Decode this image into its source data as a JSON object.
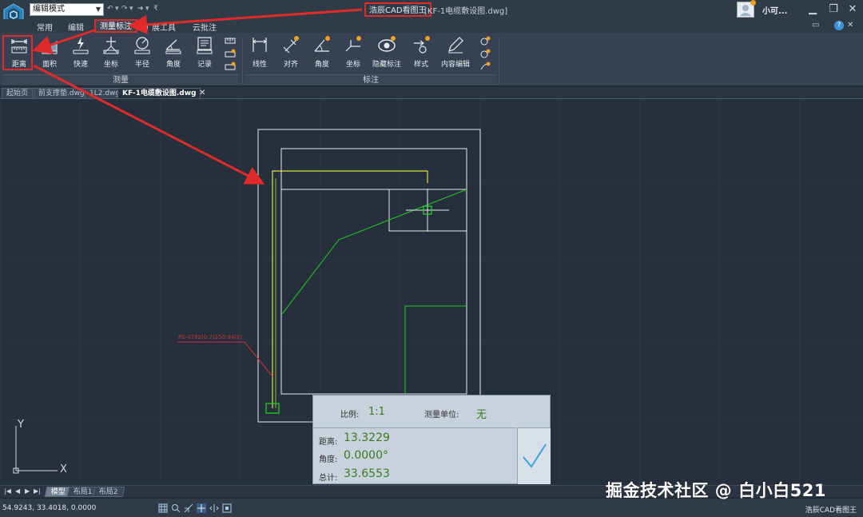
{
  "titlebar": {
    "mode_value": "编辑模式",
    "app_name": "浩辰CAD看图王",
    "file_title": "[KF-1电缆敷设图.dwg]",
    "username": "小可..."
  },
  "menu": {
    "tabs": [
      {
        "label": "常用"
      },
      {
        "label": "编辑"
      },
      {
        "label": "测量标注"
      },
      {
        "label": "扩展工具"
      },
      {
        "label": "云批注"
      }
    ]
  },
  "ribbon": {
    "measure_group": {
      "label": "测量",
      "buttons": [
        {
          "label": "距离"
        },
        {
          "label": "面积"
        },
        {
          "label": "快速"
        },
        {
          "label": "坐标"
        },
        {
          "label": "半径"
        },
        {
          "label": "角度"
        },
        {
          "label": "记录"
        }
      ]
    },
    "annotate_group": {
      "label": "标注",
      "buttons": [
        {
          "label": "线性"
        },
        {
          "label": "对齐"
        },
        {
          "label": "角度"
        },
        {
          "label": "坐标"
        },
        {
          "label": "隐藏标注"
        },
        {
          "label": "样式"
        },
        {
          "label": "内容编辑"
        }
      ]
    }
  },
  "doc_tabs": [
    {
      "label": "起始页"
    },
    {
      "label": "前支撑垫.dwg"
    },
    {
      "label": "1L2.dwg"
    },
    {
      "label": "KF-1电缆敷设图.dwg"
    }
  ],
  "drawing": {
    "annotation_text": "PS-4792(0.7)150-94(E)",
    "axis_y": "Y",
    "axis_x": "X"
  },
  "measure_panel": {
    "scale_label": "比例:",
    "scale_value": "1:1",
    "unit_label": "测量单位:",
    "unit_value": "无",
    "distance_label": "距离:",
    "distance_value": "13.3229",
    "angle_label": "角度:",
    "angle_value": "0.0000°",
    "total_label": "总计:",
    "total_value": "33.6553"
  },
  "layout_tabs": [
    {
      "label": "模型"
    },
    {
      "label": "布局1"
    },
    {
      "label": "布局2"
    }
  ],
  "statusbar": {
    "coords": "54.9243, 33.4018, 0.0000",
    "app_name": "浩辰CAD看图王"
  },
  "watermark": "掘金技术社区 @ 白小白521",
  "colors": {
    "highlight_red": "#e12b2b",
    "canvas_bg": "#26303d",
    "ribbon_bg": "#364251",
    "measure_green": "#3c7a1f",
    "line_green": "#22cc22",
    "line_yellow": "#d8e04a"
  }
}
